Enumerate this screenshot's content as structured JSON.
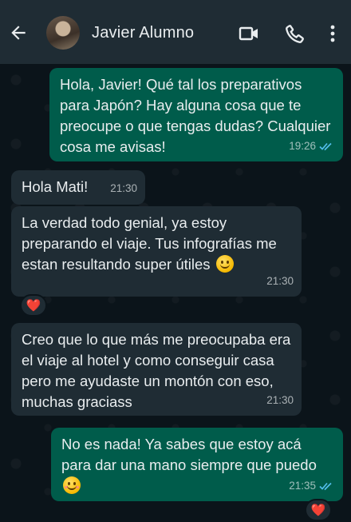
{
  "header": {
    "contact_name": "Javier Alumno",
    "icons": [
      "back-arrow-icon",
      "video-call-icon",
      "phone-icon",
      "more-options-icon"
    ]
  },
  "messages": [
    {
      "direction": "outgoing",
      "text": "Hola, Javier! Qué tal los preparativos para Japón? Hay alguna cosa que te preocupe o que tengas dudas? Cualquier cosa me avisas!",
      "time": "19:26",
      "status": "read"
    },
    {
      "direction": "incoming",
      "text": "Hola Mati!",
      "time": "21:30"
    },
    {
      "direction": "incoming",
      "text": "La verdad todo genial, ya estoy preparando el viaje. Tus infografías me estan resultando super útiles",
      "time": "21:30",
      "emoji": "slightly-smiling-face",
      "reaction": "❤️"
    },
    {
      "direction": "incoming",
      "text": "Creo que lo que más me preocupaba era el viaje al hotel y como conseguir casa pero me ayudaste un montón con eso, muchas graciass",
      "time": "21:30"
    },
    {
      "direction": "outgoing",
      "text": "No es nada! Ya sabes que estoy acá para dar una mano siempre que puedo",
      "time": "21:35",
      "status": "read",
      "emoji": "smiling-face-with-blush",
      "reaction": "❤️"
    }
  ],
  "colors": {
    "background": "#0b141a",
    "header": "#1f2c34",
    "outgoing_bubble": "#005c4b",
    "incoming_bubble": "#1f2c34",
    "read_ticks": "#53bdeb",
    "heart": "#e8313b"
  }
}
